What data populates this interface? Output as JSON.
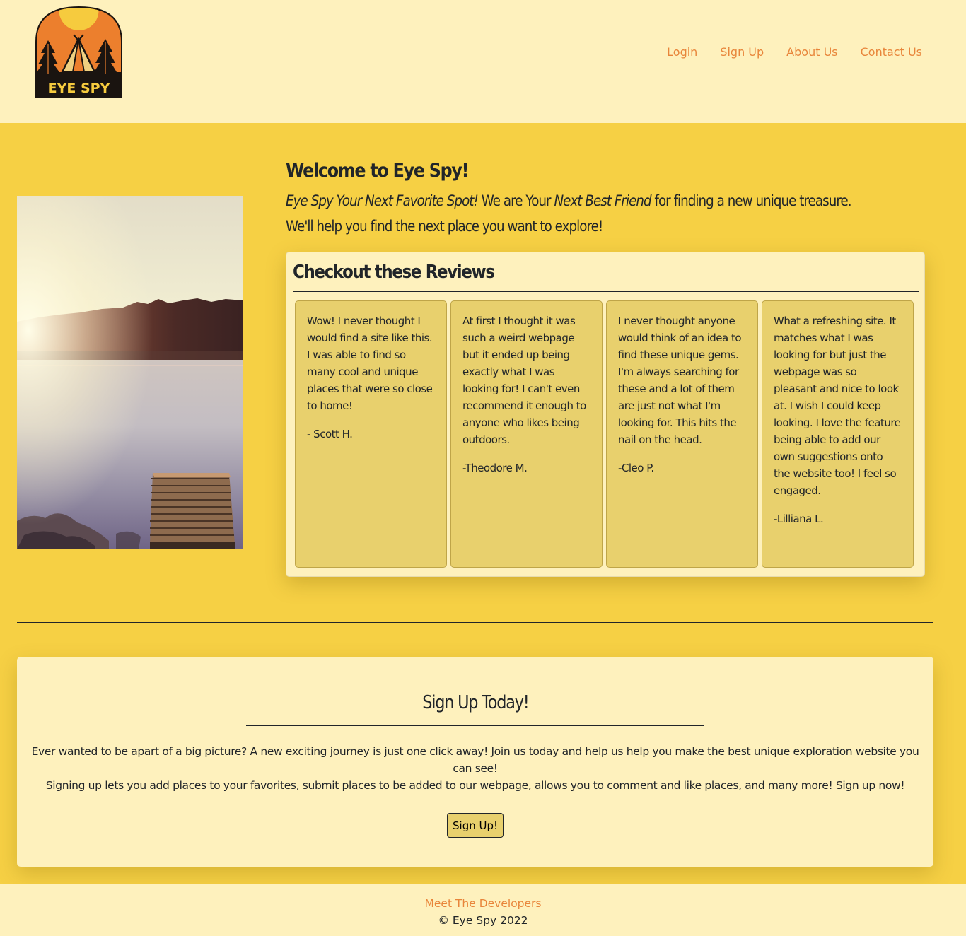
{
  "brand": {
    "logo_text": "EYE SPY"
  },
  "nav": {
    "items": [
      {
        "label": "Login"
      },
      {
        "label": "Sign Up"
      },
      {
        "label": "About Us"
      },
      {
        "label": "Contact Us"
      }
    ]
  },
  "welcome": {
    "title": "Welcome to Eye Spy!",
    "tagline": "Eye Spy Your Next Favorite Spot!",
    "text_1": " We are Your ",
    "emphasis": "Next Best Friend",
    "text_2": " for finding a new unique treasure. We'll help you find the next place you want to explore!"
  },
  "reviews": {
    "title": "Checkout these Reviews",
    "items": [
      {
        "text": "Wow! I never thought I would find a site like this. I was able to find so many cool and unique places that were so close to home!",
        "author": "- Scott H."
      },
      {
        "text": "At first I thought it was such a weird webpage but it ended up being exactly what I was looking for! I can't even recommend it enough to anyone who likes being outdoors.",
        "author": "-Theodore M."
      },
      {
        "text": "I never thought anyone would think of an idea to find these unique gems. I'm always searching for these and a lot of them are just not what I'm looking for. This hits the nail on the head.",
        "author": "-Cleo P."
      },
      {
        "text": "What a refreshing site. It matches what I was looking for but just the webpage was so pleasant and nice to look at. I wish I could keep looking. I love the feature being able to add our own suggestions onto the website too! I feel so engaged.",
        "author": "-Lilliana L."
      }
    ]
  },
  "signup": {
    "title": "Sign Up Today!",
    "line_1": "Ever wanted to be apart of a big picture? A new exciting journey is just one click away! Join us today and help us help you make the best unique exploration website you can see!",
    "line_2": "Signing up lets you add places to your favorites, submit places to be added to our webpage, allows you to comment and like places, and many more! Sign up now!",
    "button_label": "Sign Up!"
  },
  "footer": {
    "link_label": "Meet The Developers",
    "copyright": "© Eye Spy 2022"
  },
  "colors": {
    "page_background": "#f6d044",
    "panel_background": "#fef1bd",
    "review_card": "#e8d06d",
    "link": "#e8853a"
  }
}
